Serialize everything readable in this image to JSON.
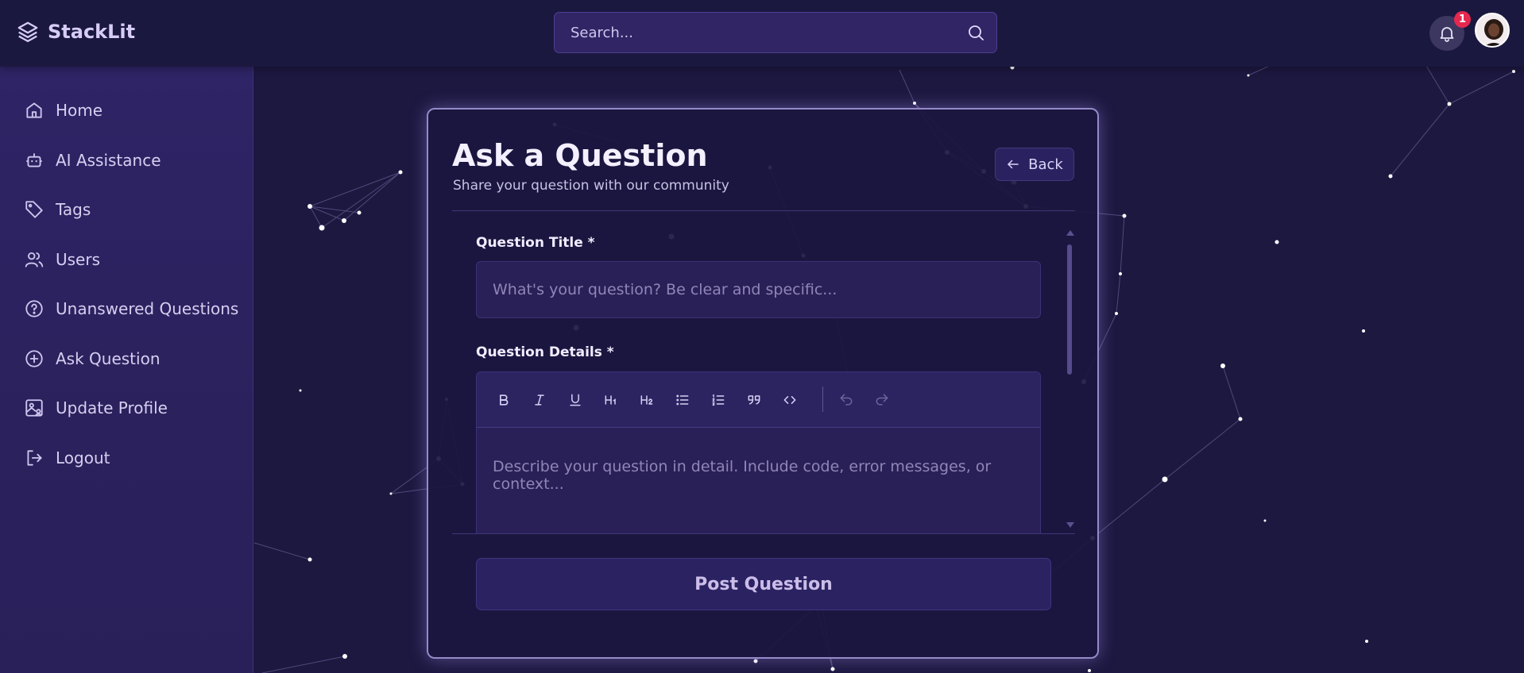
{
  "app": {
    "name": "StackLit"
  },
  "header": {
    "search_placeholder": "Search...",
    "notification_count": "1"
  },
  "sidebar": {
    "items": [
      {
        "label": "Home",
        "icon": "home-icon"
      },
      {
        "label": "AI Assistance",
        "icon": "bot-icon"
      },
      {
        "label": "Tags",
        "icon": "tag-icon"
      },
      {
        "label": "Users",
        "icon": "users-icon"
      },
      {
        "label": "Unanswered Questions",
        "icon": "help-circle-icon"
      },
      {
        "label": "Ask Question",
        "icon": "plus-circle-icon"
      },
      {
        "label": "Update Profile",
        "icon": "image-user-icon"
      },
      {
        "label": "Logout",
        "icon": "logout-icon"
      }
    ]
  },
  "form": {
    "title": "Ask a Question",
    "subtitle": "Share your question with our community",
    "back_label": "Back",
    "title_label": "Question Title *",
    "title_placeholder": "What's your question? Be clear and specific...",
    "details_label": "Question Details *",
    "details_placeholder": "Describe your question in detail. Include code, error messages, or context...",
    "submit_label": "Post Question",
    "toolbar": [
      "bold",
      "italic",
      "underline",
      "h1",
      "h2",
      "bullet-list",
      "ordered-list",
      "blockquote",
      "code",
      "undo",
      "redo"
    ]
  },
  "colors": {
    "background": "#1c1840",
    "sidebar": "#2e2466",
    "accent": "#9689c9",
    "badge": "#e6284f"
  }
}
